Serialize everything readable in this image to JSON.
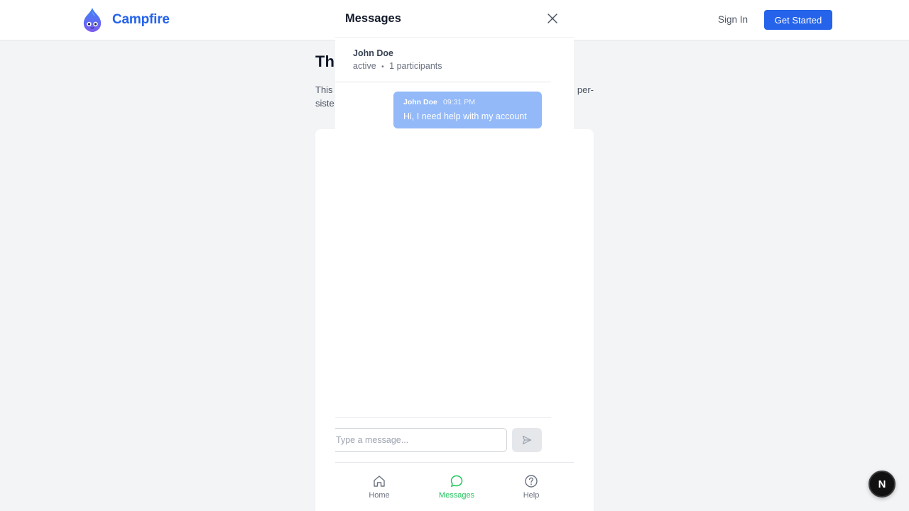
{
  "navbar": {
    "brand_name": "Campfire",
    "signin_label": "Sign In",
    "get_started_label": "Get Started"
  },
  "page": {
    "title_fragment": "Thr",
    "desc_left_line1": "This",
    "desc_right_line1": "per-",
    "desc_left_line2": "siste"
  },
  "widget": {
    "title": "Messages",
    "conversation": {
      "name": "John Doe",
      "status": "active",
      "separator": "•",
      "participants": "1 participants"
    },
    "messages": [
      {
        "author": "John Doe",
        "time": "09:31 PM",
        "text": "Hi, I need help with my account"
      }
    ],
    "composer": {
      "placeholder": "Type a message..."
    },
    "bottom_nav": [
      {
        "label": "Home",
        "icon": "home-icon",
        "active": false
      },
      {
        "label": "Messages",
        "icon": "message-circle-icon",
        "active": true
      },
      {
        "label": "Help",
        "icon": "help-circle-icon",
        "active": false
      }
    ]
  },
  "dev_badge": {
    "letter": "N"
  },
  "colors": {
    "brand": "#2563eb",
    "active_nav": "#22c55e",
    "bubble": "#93b9f9",
    "page_bg": "#f3f4f6"
  }
}
